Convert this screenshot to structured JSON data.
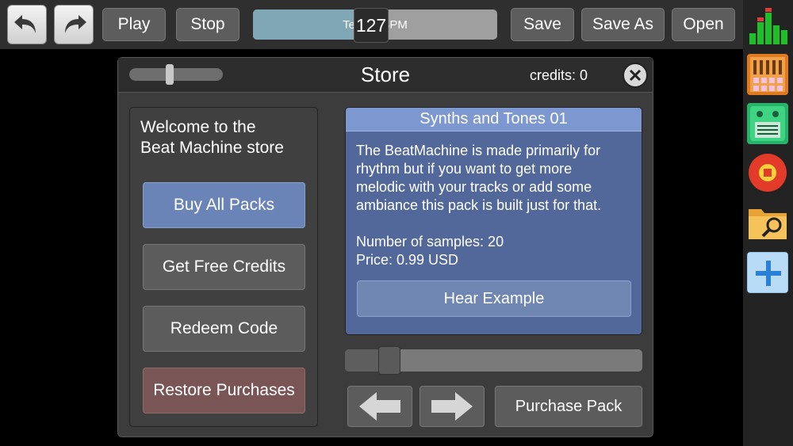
{
  "toolbar": {
    "undo_icon": "undo-icon",
    "redo_icon": "redo-icon",
    "play_label": "Play",
    "stop_label": "Stop",
    "tempo_label": "Tempo BPM",
    "tempo_value": "127",
    "tempo_level_fraction": 0.41,
    "save_label": "Save",
    "save_as_label": "Save As",
    "open_label": "Open"
  },
  "sidebar": {
    "items": [
      {
        "name": "level-meter-icon"
      },
      {
        "name": "drum-pad-icon"
      },
      {
        "name": "synth-icon"
      },
      {
        "name": "record-icon"
      },
      {
        "name": "folder-search-icon"
      },
      {
        "name": "add-icon"
      }
    ]
  },
  "store": {
    "title": "Store",
    "credits": "credits: 0",
    "volume_level_fraction": 0.43,
    "welcome_line1": "Welcome to the",
    "welcome_line2": "Beat Machine store",
    "buttons": {
      "buy_all": "Buy All Packs",
      "free_credits": "Get Free Credits",
      "redeem": "Redeem Code",
      "restore": "Restore Purchases"
    },
    "pack": {
      "title": "Synths and Tones 01",
      "description_lines": [
        "The BeatMachine is made primarily for",
        "rhythm but if you want to get more",
        "melodic with your tracks or add some",
        "ambiance this pack is built just for that."
      ],
      "samples": "Number of samples: 20",
      "price": "Price: 0.99 USD",
      "hear_label": "Hear Example"
    },
    "page_slider_fraction": 0.15,
    "purchase_label": "Purchase Pack"
  },
  "colors": {
    "accent_blue": "#6b84b8",
    "detail_bg": "#53689a",
    "restore_red": "#7a5555"
  }
}
